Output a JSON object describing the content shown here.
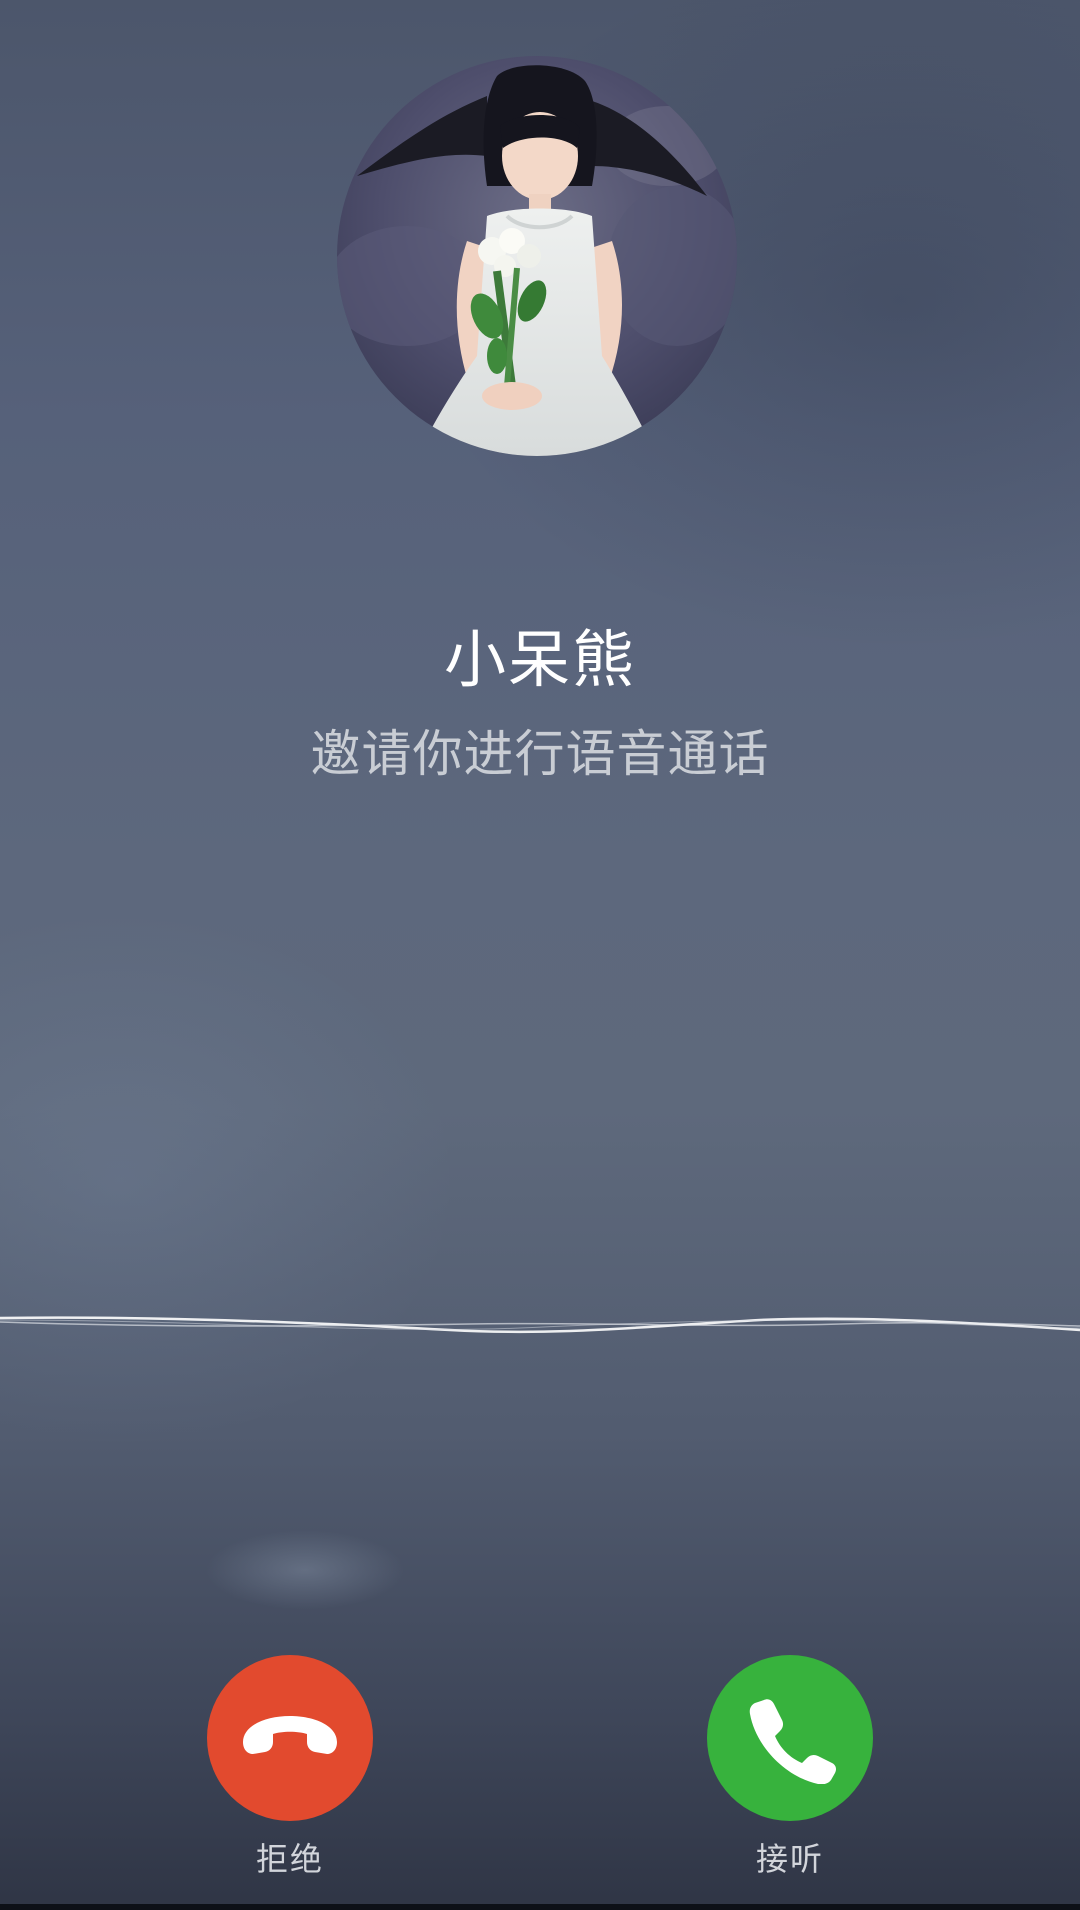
{
  "call": {
    "caller_name": "小呆熊",
    "status_text": "邀请你进行语音通话"
  },
  "actions": {
    "decline_label": "拒绝",
    "answer_label": "接听"
  },
  "colors": {
    "decline": "#e24a2e",
    "answer": "#37b23d",
    "name_text": "#ffffff",
    "status_text": "#c9cdd4"
  },
  "icons": {
    "decline": "phone-hangup-icon",
    "answer": "phone-answer-icon"
  }
}
